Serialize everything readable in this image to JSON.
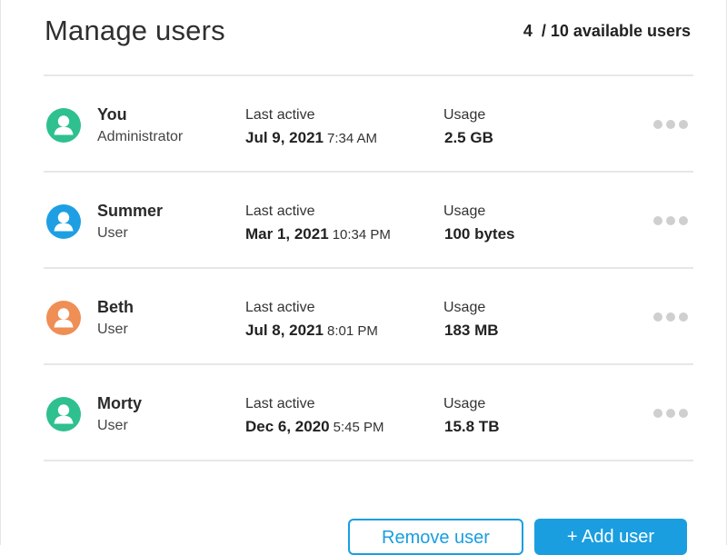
{
  "header": {
    "title": "Manage users",
    "count": "4  / 10 available users"
  },
  "users": [
    {
      "name": "You",
      "role": "Administrator",
      "last_active_label": "Last active",
      "last_active_date": "Jul 9, 2021",
      "last_active_time": "7:34 AM",
      "usage_label": "Usage",
      "usage_value": "2.5 GB",
      "avatar_color": "#2ec08e",
      "avatar_icon": "user-icon",
      "menu_icon": "more-options-icon"
    },
    {
      "name": "Summer",
      "role": "User",
      "last_active_label": "Last active",
      "last_active_date": "Mar 1, 2021",
      "last_active_time": "10:34 PM",
      "usage_label": "Usage",
      "usage_value": "100 bytes",
      "avatar_color": "#1e9fe3",
      "avatar_icon": "user-icon",
      "menu_icon": "more-options-icon"
    },
    {
      "name": "Beth",
      "role": "User",
      "last_active_label": "Last active",
      "last_active_date": "Jul 8, 2021",
      "last_active_time": "8:01 PM",
      "usage_label": "Usage",
      "usage_value": "183 MB",
      "avatar_color": "#ef8e55",
      "avatar_icon": "user-icon",
      "menu_icon": "more-options-icon"
    },
    {
      "name": "Morty",
      "role": "User",
      "last_active_label": "Last active",
      "last_active_date": "Dec 6, 2020",
      "last_active_time": "5:45 PM",
      "usage_label": "Usage",
      "usage_value": "15.8 TB",
      "avatar_color": "#2ec08e",
      "avatar_icon": "user-icon",
      "menu_icon": "more-options-icon"
    }
  ],
  "actions": {
    "remove_label": "Remove user",
    "add_label": "+ Add user"
  },
  "colors": {
    "accent": "#1a9ee0",
    "divider": "#e7e7e7",
    "menu_dots": "#cfcfcf"
  }
}
